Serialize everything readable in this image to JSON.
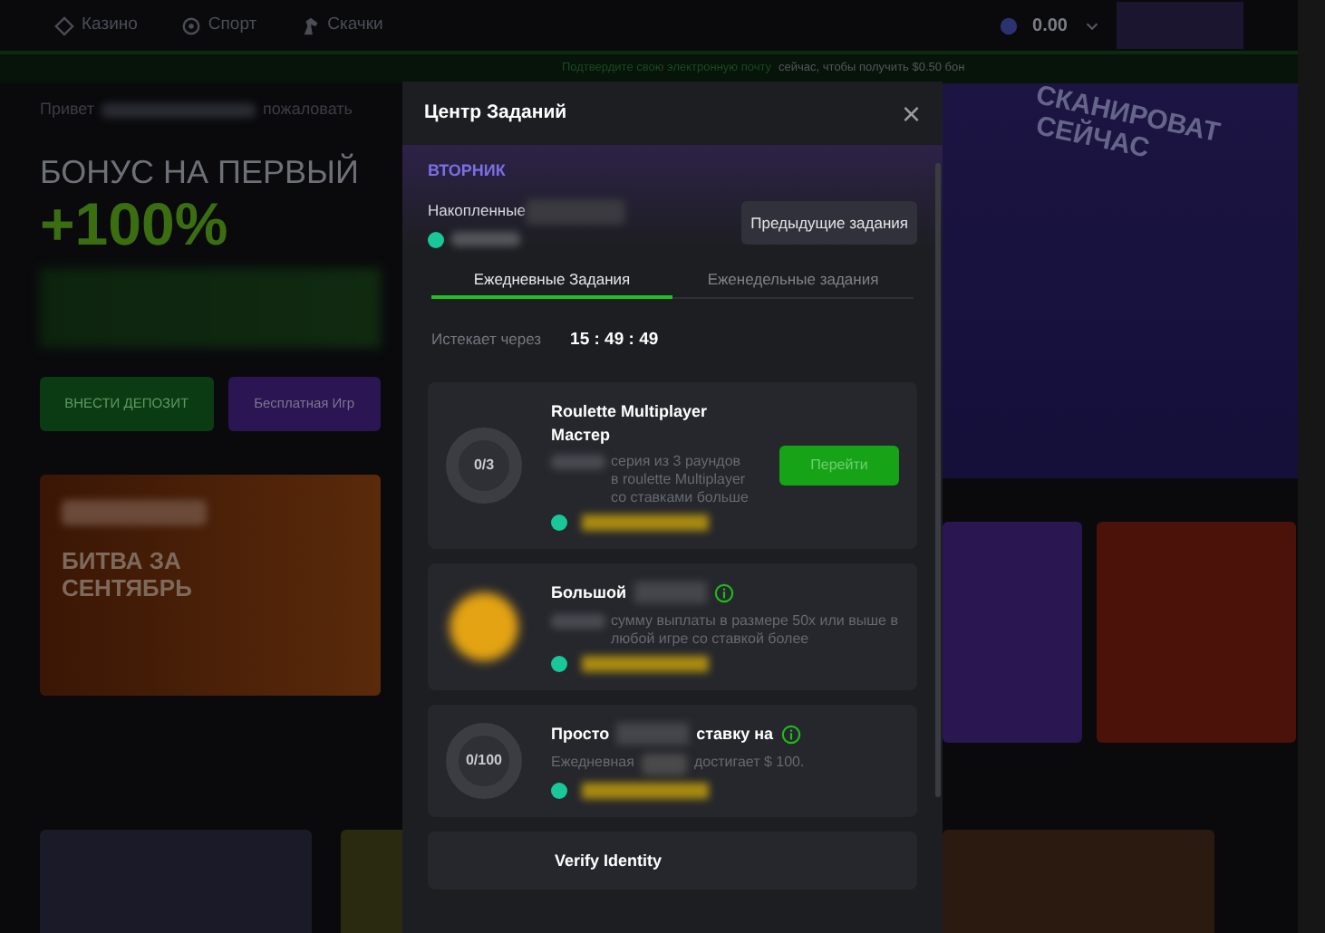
{
  "nav": {
    "items": [
      {
        "label": "Казино"
      },
      {
        "label": "Спорт"
      },
      {
        "label": "Скачки"
      }
    ],
    "balance": "0.00"
  },
  "notice": {
    "link": "Подтвердите свою электронную почту",
    "text": "сейчас, чтобы получить $0.50 бон"
  },
  "hero": {
    "greeting": "Привет",
    "greeting_end": "пожаловать",
    "title": "БОНУС НА ПЕРВЫЙ",
    "bonus": "+100%",
    "buttons": [
      {
        "label": "ВНЕСТИ ДЕПОЗИТ",
        "kind": "deposit"
      },
      {
        "label": "Бесплатная Игр",
        "kind": "free"
      }
    ]
  },
  "promo": {
    "title": "БИТВА ЗА СЕНТЯБРЬ"
  },
  "arcade": {
    "lines": [
      "СКАНИРОВАТ",
      "СЕЙЧАС"
    ]
  },
  "modal": {
    "title": "Центр Заданий",
    "close": "×",
    "day": "ВТОРНИК",
    "accumulated": "Накопленные",
    "previous": "Предыдущие задания",
    "tabs": [
      {
        "label": "Ежедневные Задания",
        "selected": true
      },
      {
        "label": "Еженедельные задания",
        "selected": false
      }
    ],
    "expires_label": "Истекает через",
    "timer": "15 : 49 : 49",
    "tasks": [
      {
        "kind": "ring",
        "progress": "0/3",
        "title": "Roulette Multiplayer Мастер",
        "description": "серия из 3 раундов в roulette Multiplayer со ставками больше",
        "button": "Перейти",
        "info": false
      },
      {
        "kind": "coin",
        "title": "Большой",
        "description": "сумму выплаты в размере 50x или выше в любой игре со ставкой более",
        "info": true
      },
      {
        "kind": "ring",
        "progress": "0/100",
        "title": "Просто",
        "title_end": "ставку на",
        "description": "Ежедневная",
        "description_end": "достигает $ 100.",
        "info": true
      },
      {
        "kind": "none",
        "title": "Verify Identity",
        "info": false
      }
    ]
  }
}
